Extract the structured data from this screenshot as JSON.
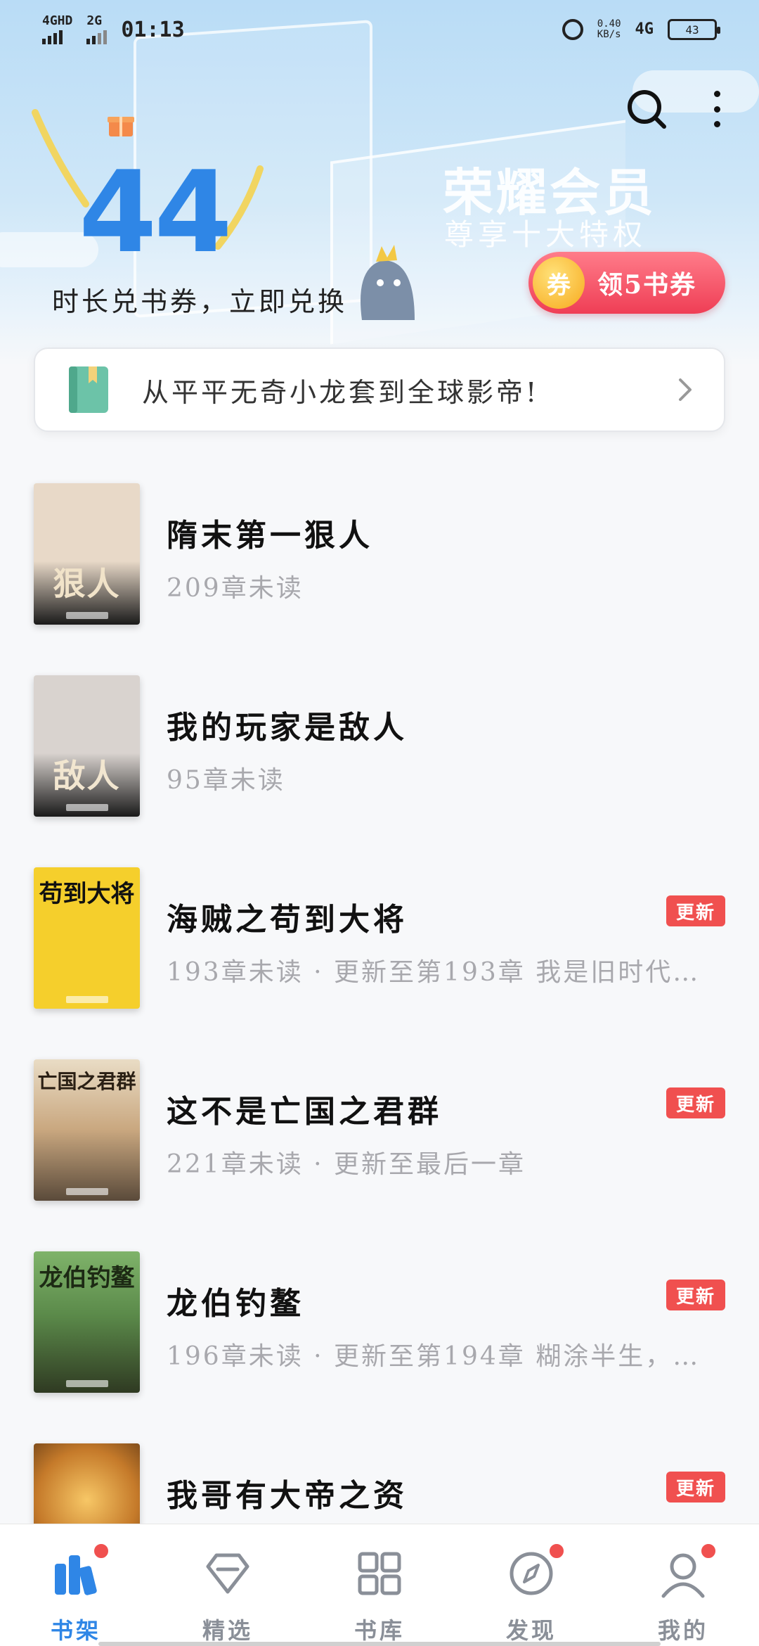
{
  "status_bar": {
    "net1": "4GHD",
    "net2": "2G",
    "time": "01:13",
    "speed_value": "0.40",
    "speed_unit": "KB/s",
    "net3": "4G",
    "battery": "43"
  },
  "banner": {
    "big_number": "44",
    "exchange_text": "时长兑书券，立即兑换 >",
    "vip_title": "荣耀会员",
    "vip_subtitle": "尊享十大特权",
    "coupon_icon_text": "券",
    "coupon_button_label": "领5书券"
  },
  "notice": {
    "text": "从平平无奇小龙套到全球影帝!"
  },
  "books": [
    {
      "title": "隋末第一狠人",
      "status": "209章未读",
      "updated": false,
      "cover_text": "狠人",
      "cover_top": "",
      "cover_bg": "#e8d9c8",
      "cover_color": "#f1e3c9"
    },
    {
      "title": "我的玩家是敌人",
      "status": "95章未读",
      "updated": false,
      "cover_text": "敌人",
      "cover_top": "",
      "cover_bg": "#d9d3cf",
      "cover_color": "#f2e6d0"
    },
    {
      "title": "海贼之苟到大将",
      "status": "193章未读 · 更新至第193章 我是旧时代…",
      "updated": true,
      "cover_text": "",
      "cover_top": "苟到大将",
      "cover_bg": "#f5cf2c",
      "cover_color": "#111111"
    },
    {
      "title": "这不是亡国之君群",
      "status": "221章未读 · 更新至最后一章",
      "updated": true,
      "cover_text": "",
      "cover_top": "亡国之君群",
      "cover_bg": "#c9a77f",
      "cover_color": "#2a1f14"
    },
    {
      "title": "龙伯钓鳌",
      "status": "196章未读 · 更新至第194章 糊涂半生，…",
      "updated": true,
      "cover_text": "",
      "cover_top": "龙伯钓鳌",
      "cover_bg": "#5b8a4a",
      "cover_color": "#1d2a14"
    },
    {
      "title": "我哥有大帝之资",
      "status": "",
      "updated": true,
      "cover_text": "",
      "cover_top": "",
      "cover_bg": "#c57a2a",
      "cover_color": "#ffffff"
    }
  ],
  "update_badge_label": "更新",
  "bottom_nav": [
    {
      "label": "书架",
      "icon": "bookshelf-icon",
      "active": true,
      "dot": true
    },
    {
      "label": "精选",
      "icon": "diamond-icon",
      "active": false,
      "dot": false
    },
    {
      "label": "书库",
      "icon": "grid-icon",
      "active": false,
      "dot": false
    },
    {
      "label": "发现",
      "icon": "compass-icon",
      "active": false,
      "dot": true
    },
    {
      "label": "我的",
      "icon": "profile-icon",
      "active": false,
      "dot": true
    }
  ],
  "colors": {
    "accent": "#2f86e6",
    "badge": "#f0504f",
    "coupon": "#ef3e55"
  }
}
